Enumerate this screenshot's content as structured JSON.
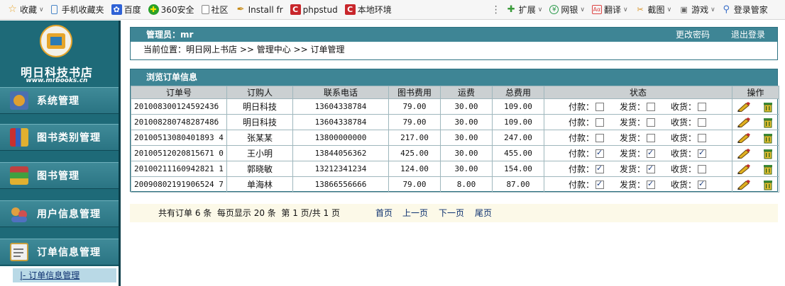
{
  "bookmarks": [
    {
      "label": "收藏",
      "icon": "star-icon",
      "caret": true
    },
    {
      "label": "手机收藏夹",
      "icon": "phone-icon",
      "caret": false
    },
    {
      "label": "百度",
      "icon": "baidu-icon",
      "caret": false
    },
    {
      "label": "360安全",
      "icon": "shield-plus-icon",
      "caret": false
    },
    {
      "label": "社区",
      "icon": "page-icon",
      "caret": false
    },
    {
      "label": "Install fr",
      "icon": "pen-icon",
      "caret": false
    },
    {
      "label": "phpstud",
      "icon": "cphp-icon",
      "caret": false
    },
    {
      "label": "本地环境",
      "icon": "cphp-icon",
      "caret": false
    }
  ],
  "toolbar_right": [
    {
      "label": "扩展",
      "icon": "puzzle-icon"
    },
    {
      "label": "网银",
      "icon": "bank-icon"
    },
    {
      "label": "翻译",
      "icon": "translate-icon"
    },
    {
      "label": "截图",
      "icon": "scissors-icon"
    },
    {
      "label": "游戏",
      "icon": "gamepad-icon"
    },
    {
      "label": "登录管家",
      "icon": "search-icon"
    }
  ],
  "logo": {
    "title": "明日科技书店",
    "url": "www.mrbooks.cn"
  },
  "menu": [
    {
      "label": "系统管理"
    },
    {
      "label": "图书类别管理"
    },
    {
      "label": "图书管理"
    },
    {
      "label": "用户信息管理"
    },
    {
      "label": "订单信息管理"
    }
  ],
  "submenu": {
    "label": "|- 订单信息管理"
  },
  "admin": {
    "label": "管理员：mr",
    "change_password": "更改密码",
    "logout": "退出登录",
    "breadcrumb": "当前位置：明日网上书店 >> 管理中心 >> 订单管理"
  },
  "orders_panel": {
    "title": "浏览订单信息",
    "columns": [
      "订单号",
      "订购人",
      "联系电话",
      "图书费用",
      "运费",
      "总费用",
      "状态",
      "操作"
    ],
    "status_labels": {
      "paid": "付款：",
      "shipped": "发货：",
      "received": "收货："
    },
    "rows": [
      {
        "order_no": "20100830012459243б",
        "buyer": "明日科技",
        "phone": "13604338784",
        "book_fee": "79.00",
        "shipping": "30.00",
        "total": "109.00",
        "paid": false,
        "shipped": false,
        "received": false
      },
      {
        "order_no": "20100828074828748б",
        "buyer": "明日科技",
        "phone": "13604338784",
        "book_fee": "79.00",
        "shipping": "30.00",
        "total": "109.00",
        "paid": false,
        "shipped": false,
        "received": false
      },
      {
        "order_no": "20100513080401893 4",
        "buyer": "张某某",
        "phone": "13800000000",
        "book_fee": "217.00",
        "shipping": "30.00",
        "total": "247.00",
        "paid": false,
        "shipped": false,
        "received": false
      },
      {
        "order_no": "20100512020815671 0",
        "buyer": "王小明",
        "phone": "13844056362",
        "book_fee": "425.00",
        "shipping": "30.00",
        "total": "455.00",
        "paid": true,
        "shipped": true,
        "received": true
      },
      {
        "order_no": "20100211160942821 1",
        "buyer": "郭晓敏",
        "phone": "13212341234",
        "book_fee": "124.00",
        "shipping": "30.00",
        "total": "154.00",
        "paid": true,
        "shipped": true,
        "received": false
      },
      {
        "order_no": "20090802191906524 7",
        "buyer": "单海林",
        "phone": "13866556666",
        "book_fee": "79.00",
        "shipping": "8.00",
        "total": "87.00",
        "paid": true,
        "shipped": true,
        "received": true
      }
    ]
  },
  "pager": {
    "summary": "共有订单 6 条  每页显示 20 条  第 1 页/共 1 页",
    "first": "首页",
    "prev": "上一页",
    "next": "下一页",
    "last": "尾页"
  },
  "colors": {
    "sidebar": "#1e6a78",
    "panel_head": "#3e8595",
    "pager_bg": "#fcf9e8"
  }
}
